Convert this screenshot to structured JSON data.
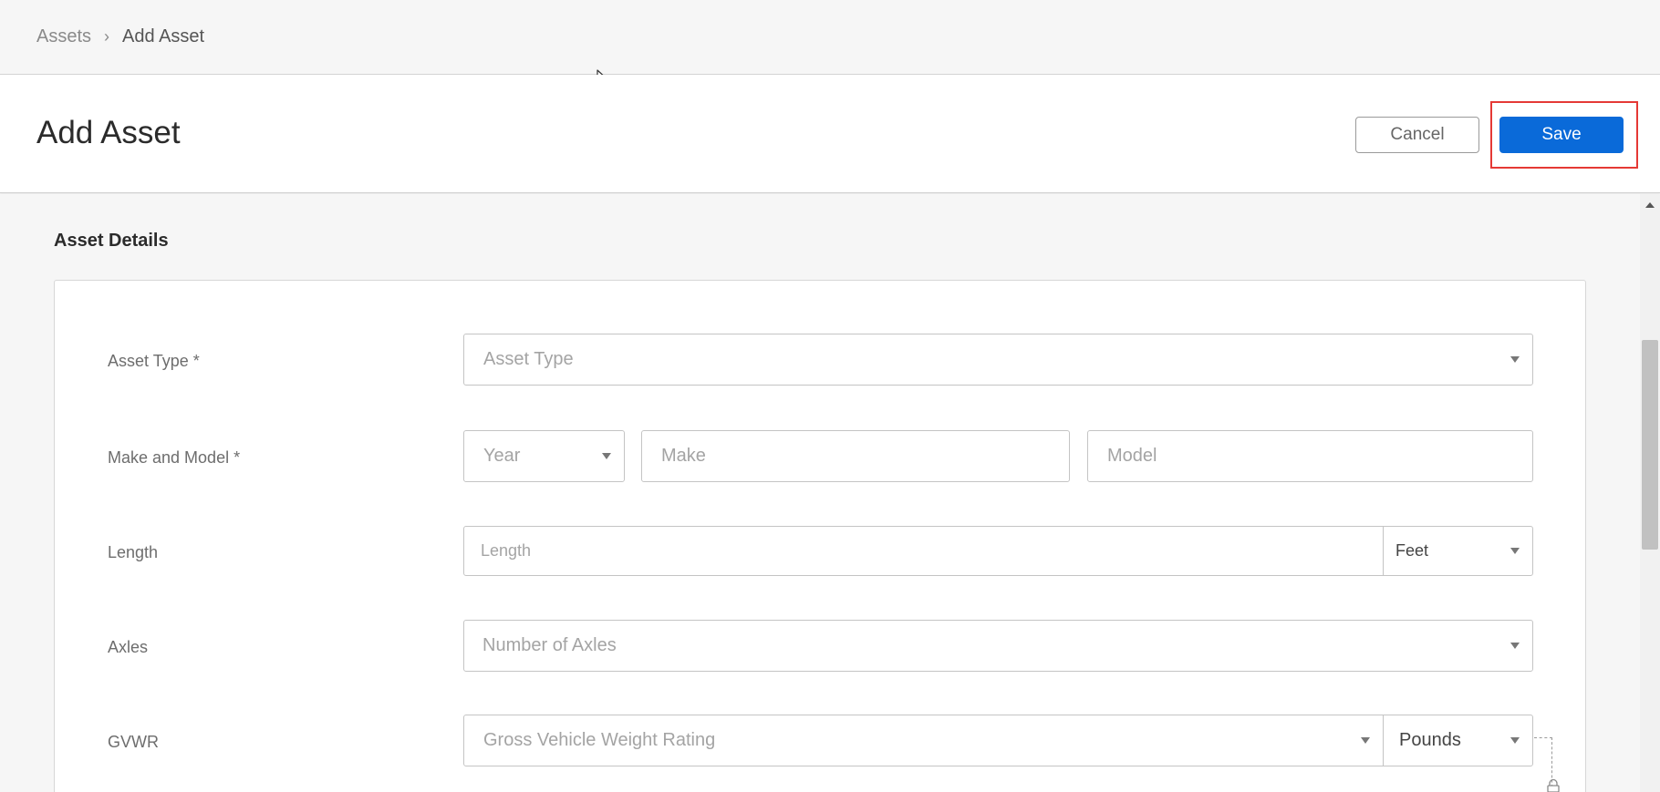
{
  "breadcrumb": {
    "parent": "Assets",
    "separator": "›",
    "current": "Add Asset"
  },
  "header": {
    "title": "Add Asset",
    "cancel_label": "Cancel",
    "save_label": "Save"
  },
  "section": {
    "title": "Asset Details"
  },
  "form": {
    "asset_type": {
      "label": "Asset Type *",
      "placeholder": "Asset Type"
    },
    "make_model": {
      "label": "Make and Model *",
      "year_placeholder": "Year",
      "make_placeholder": "Make",
      "model_placeholder": "Model"
    },
    "length": {
      "label": "Length",
      "placeholder": "Length",
      "unit": "Feet"
    },
    "axles": {
      "label": "Axles",
      "placeholder": "Number of Axles"
    },
    "gvwr": {
      "label": "GVWR",
      "placeholder": "Gross Vehicle Weight Rating",
      "unit": "Pounds"
    }
  },
  "colors": {
    "primary": "#0a6ad9",
    "highlight": "#e53935",
    "background": "#f6f6f6"
  },
  "icons": [
    "chevron-right-icon",
    "caret-down-icon",
    "mouse-cursor-icon",
    "lock-icon",
    "scroll-up-arrow-icon"
  ]
}
